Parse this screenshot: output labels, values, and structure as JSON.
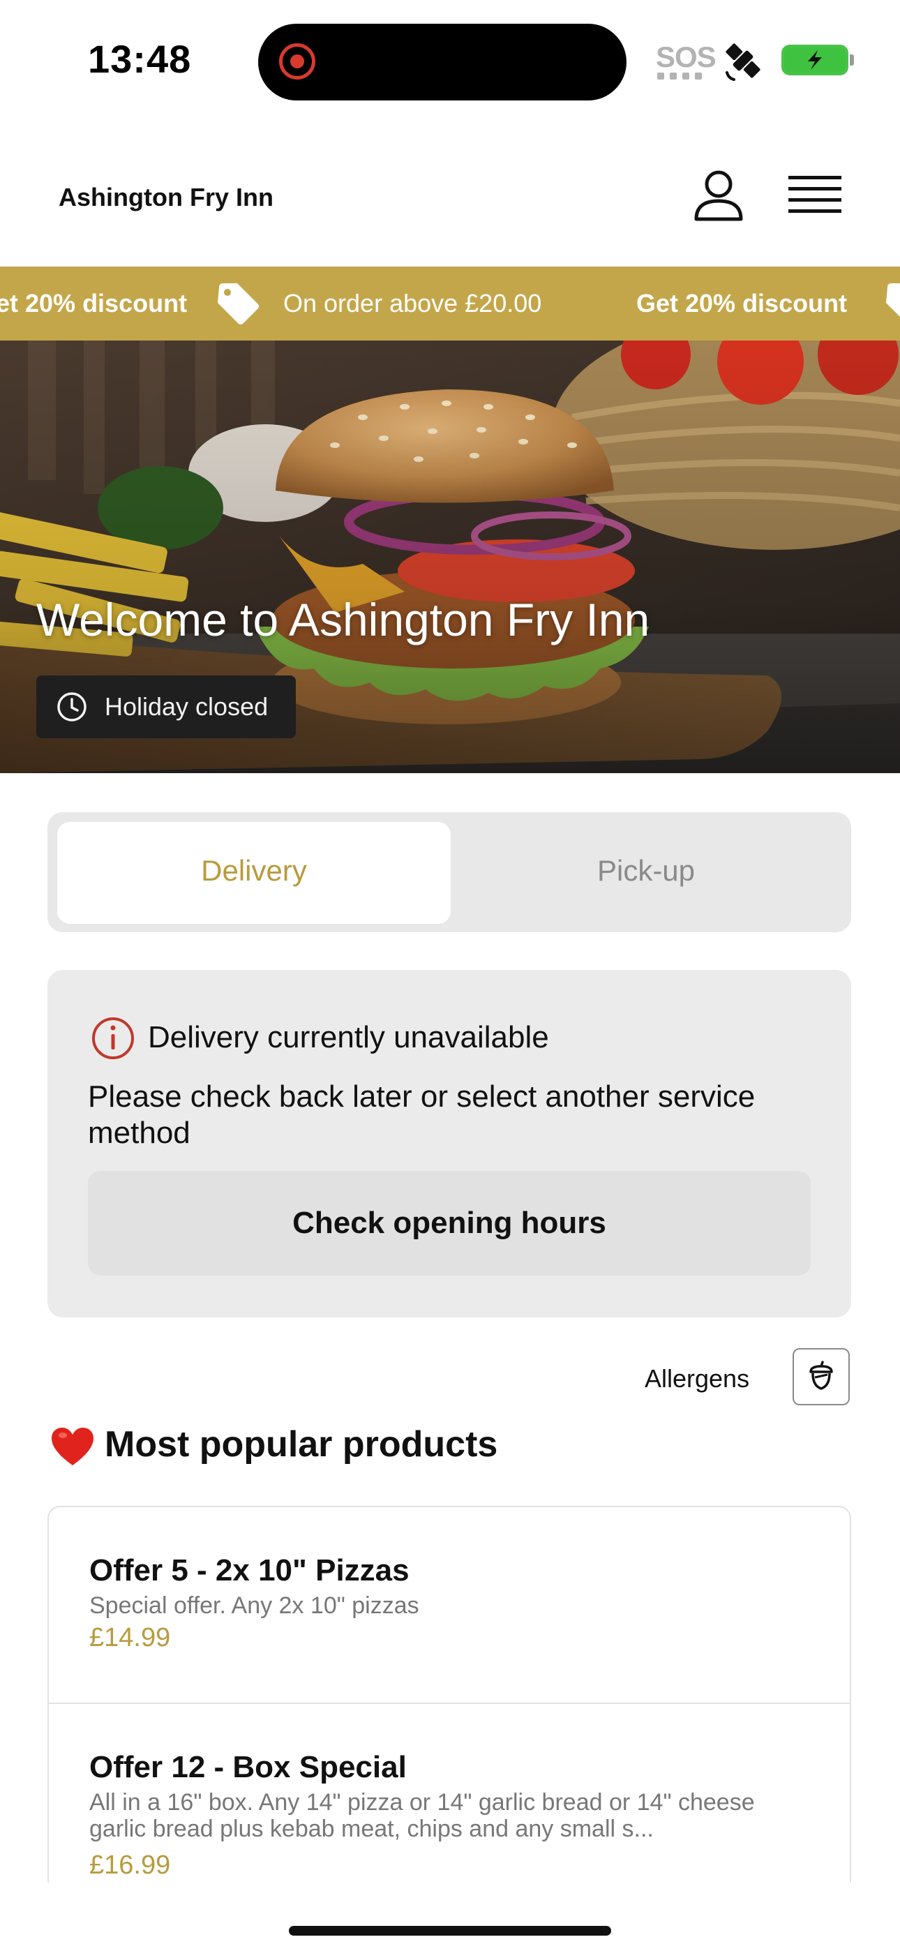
{
  "status_bar": {
    "time": "13:48",
    "sos": "SOS",
    "icons": [
      "record-icon",
      "satellite-icon",
      "battery-charging-icon"
    ]
  },
  "header": {
    "brand": "Ashington Fry Inn",
    "icons": [
      "user-icon",
      "menu-icon"
    ]
  },
  "ticker": {
    "items": [
      {
        "text": "et 20% discount",
        "bold": true
      },
      {
        "text": "On order above £20.00",
        "bold": false
      },
      {
        "text": "Get 20% discount",
        "bold": true
      }
    ],
    "icon": "tag-icon",
    "background": "#c4a64a"
  },
  "hero": {
    "title": "Welcome to Ashington Fry Inn",
    "status": "Holiday closed",
    "status_icon": "clock-icon"
  },
  "service_toggle": {
    "options": [
      "Delivery",
      "Pick-up"
    ],
    "selected": "Delivery",
    "accent": "#b89b3e"
  },
  "notice": {
    "title": "Delivery currently unavailable",
    "body": "Please check back later or select another service method",
    "button": "Check opening hours",
    "icon": "info-icon",
    "icon_color": "#c0392b"
  },
  "allergens": {
    "label": "Allergens",
    "icon": "acorn-icon"
  },
  "popular": {
    "title": "Most popular products",
    "icon": "heart-icon",
    "products": [
      {
        "name": "Offer 5 - 2x 10\" Pizzas",
        "description": "Special offer. Any 2x 10\" pizzas",
        "price": "£14.99"
      },
      {
        "name": "Offer 12 - Box Special",
        "description": "All in a 16\" box. Any 14\" pizza or 14\" garlic bread or 14\" cheese garlic bread plus kebab meat, chips and any small s...",
        "price": "£16.99"
      }
    ]
  }
}
